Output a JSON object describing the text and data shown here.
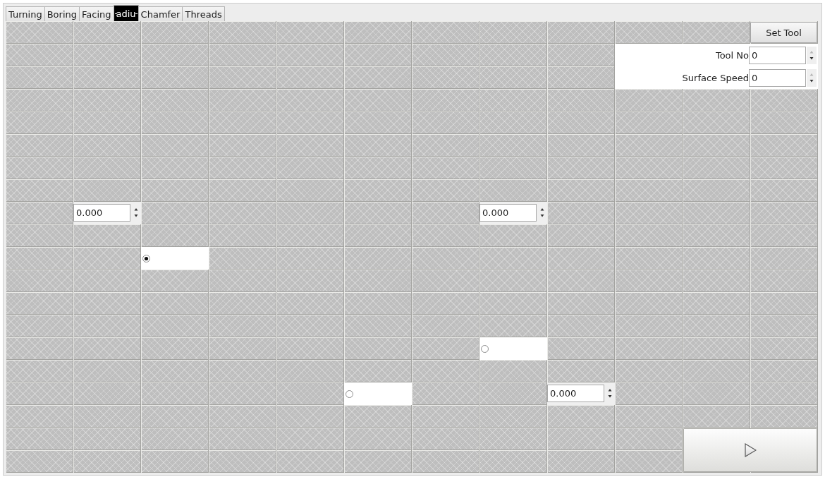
{
  "tabs": [
    {
      "label": "Turning",
      "selected": false
    },
    {
      "label": "Boring",
      "selected": false
    },
    {
      "label": "Facing",
      "selected": false
    },
    {
      "label": "adiu",
      "selected": true
    },
    {
      "label": "Chamfer",
      "selected": false
    },
    {
      "label": "Threads",
      "selected": false
    }
  ],
  "set_tool_button": {
    "label": "Set Tool"
  },
  "tool_settings": [
    {
      "label": "Tool No",
      "value": "0"
    },
    {
      "label": "Surface Speed",
      "value": "0"
    }
  ],
  "grid_widgets": [
    {
      "kind": "spinbox",
      "value": "0.000"
    },
    {
      "kind": "spinbox",
      "value": "0.000"
    },
    {
      "kind": "radio",
      "selected": true
    },
    {
      "kind": "radio",
      "selected": false
    },
    {
      "kind": "radio",
      "selected": false
    },
    {
      "kind": "spinbox",
      "value": "0.000"
    }
  ]
}
